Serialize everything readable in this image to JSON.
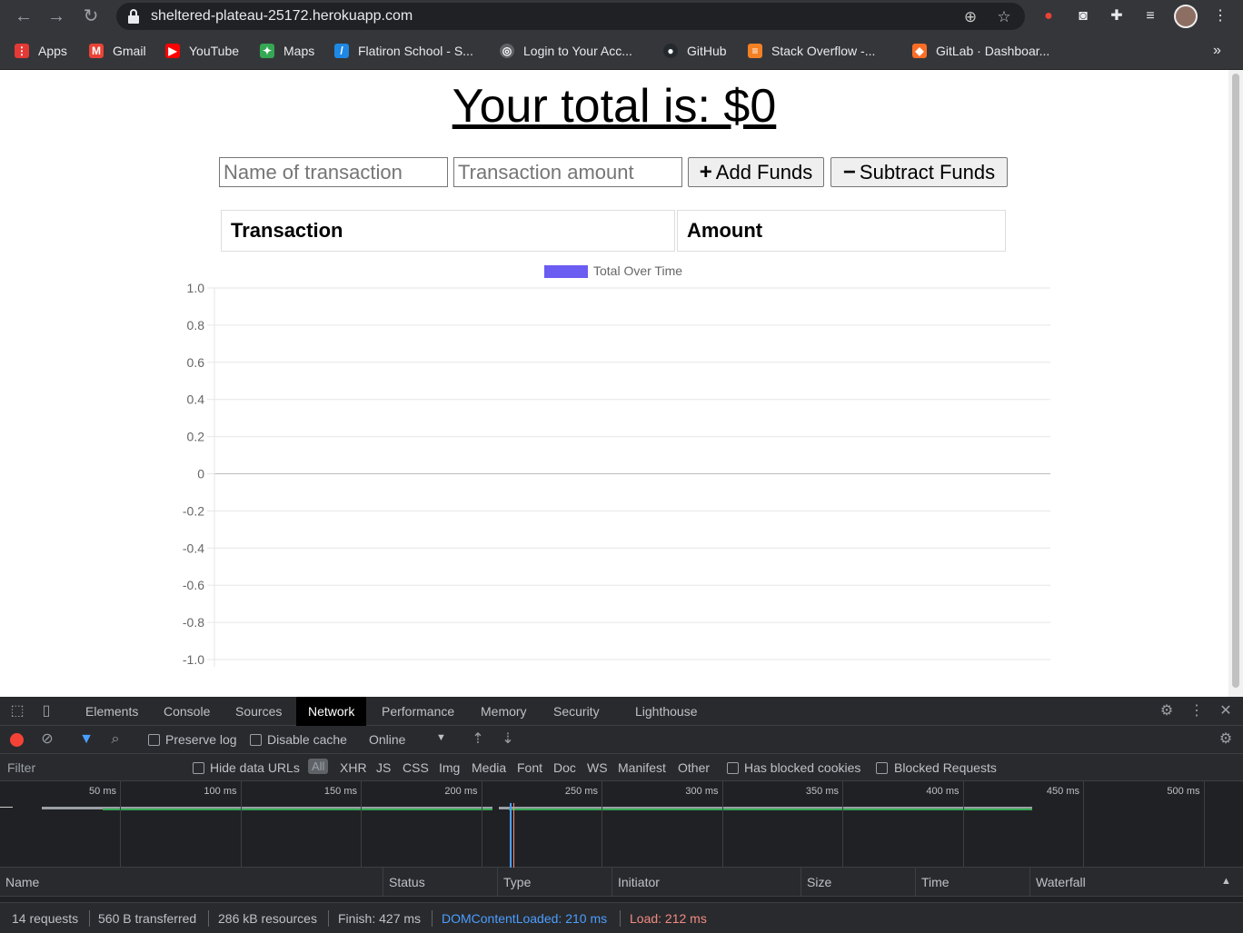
{
  "browser": {
    "url": "sheltered-plateau-25172.herokuapp.com",
    "bookmarks": [
      {
        "label": "Apps",
        "icon": "apps-grid-icon"
      },
      {
        "label": "Gmail",
        "icon": "gmail-icon"
      },
      {
        "label": "YouTube",
        "icon": "youtube-icon"
      },
      {
        "label": "Maps",
        "icon": "maps-icon"
      },
      {
        "label": "Flatiron School - S...",
        "icon": "flatiron-icon"
      },
      {
        "label": "Login to Your Acc...",
        "icon": "globe-icon"
      },
      {
        "label": "GitHub",
        "icon": "github-icon"
      },
      {
        "label": "Stack Overflow -...",
        "icon": "stackoverflow-icon"
      },
      {
        "label": "GitLab · Dashboar...",
        "icon": "gitlab-icon"
      }
    ],
    "more_bookmarks": "»"
  },
  "app": {
    "total_text": "Your total is: $0",
    "name_placeholder": "Name of transaction",
    "amount_placeholder": "Transaction amount",
    "add_label": "Add Funds",
    "add_symbol": "+",
    "subtract_label": "Subtract Funds",
    "subtract_symbol": "−",
    "table": {
      "headers": [
        "Transaction",
        "Amount"
      ]
    }
  },
  "chart_data": {
    "type": "line",
    "series": [
      {
        "name": "Total Over Time",
        "values": [],
        "color": "#6b5cf2"
      }
    ],
    "categories": [],
    "ylim": [
      -1.0,
      1.0
    ],
    "yticks": [
      "1.0",
      "0.8",
      "0.6",
      "0.4",
      "0.2",
      "0",
      "-0.2",
      "-0.4",
      "-0.6",
      "-0.8",
      "-1.0"
    ],
    "grid": true,
    "legend": "top-center"
  },
  "devtools": {
    "tabs": [
      "Elements",
      "Console",
      "Sources",
      "Network",
      "Performance",
      "Memory",
      "Security",
      "Lighthouse"
    ],
    "active_tab": "Network",
    "preserve_log": "Preserve log",
    "disable_cache": "Disable cache",
    "throttle": "Online",
    "filter_placeholder": "Filter",
    "hide_data_urls": "Hide data URLs",
    "filter_types": [
      "All",
      "XHR",
      "JS",
      "CSS",
      "Img",
      "Media",
      "Font",
      "Doc",
      "WS",
      "Manifest",
      "Other"
    ],
    "has_blocked_cookies": "Has blocked cookies",
    "blocked_requests": "Blocked Requests",
    "timeline_ticks": [
      "50 ms",
      "100 ms",
      "150 ms",
      "200 ms",
      "250 ms",
      "300 ms",
      "350 ms",
      "400 ms",
      "450 ms",
      "500 ms"
    ],
    "columns": [
      "Name",
      "Status",
      "Type",
      "Initiator",
      "Size",
      "Time",
      "Waterfall"
    ],
    "status": {
      "requests": "14 requests",
      "transferred": "560 B transferred",
      "resources": "286 kB resources",
      "finish": "Finish: 427 ms",
      "dcl": "DOMContentLoaded: 210 ms",
      "load": "Load: 212 ms"
    },
    "colors": {
      "dcl": "#4a9eff",
      "load": "#f28b82"
    }
  }
}
